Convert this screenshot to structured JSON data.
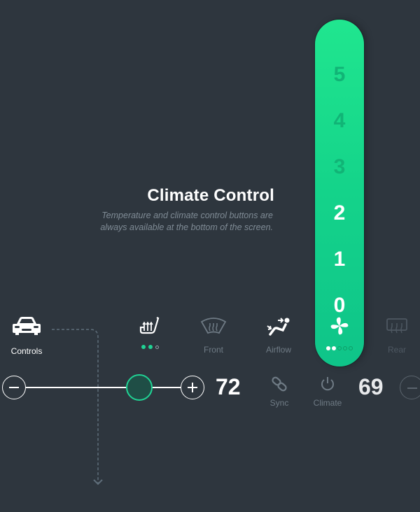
{
  "heading": {
    "title": "Climate Control",
    "subtitle_line1": "Temperature and climate control buttons are",
    "subtitle_line2": "always available at the bottom of the screen."
  },
  "fan_speed": {
    "levels": [
      "5",
      "4",
      "3",
      "2",
      "1",
      "0"
    ],
    "current_level": 2,
    "icon": "fan-icon",
    "page_dots_total": 5,
    "page_dots_active": 2,
    "accent_color": "#18d98b"
  },
  "nav": {
    "controls": {
      "label": "Controls",
      "icon": "car-icon"
    },
    "seat_heater": {
      "icon": "seat-heater-icon",
      "level": 2,
      "max": 3
    },
    "front": {
      "label": "Front",
      "icon": "front-defrost-icon"
    },
    "airflow": {
      "label": "Airflow",
      "icon": "airflow-icon"
    },
    "rear": {
      "label": "Rear",
      "icon": "rear-defrost-icon"
    }
  },
  "temperature": {
    "driver": "72",
    "passenger": "69",
    "slider_position": 0.7,
    "sync_label": "Sync",
    "climate_label": "Climate"
  },
  "colors": {
    "background": "#2e363e",
    "accent": "#20d394",
    "muted_text": "#7f8b95"
  }
}
